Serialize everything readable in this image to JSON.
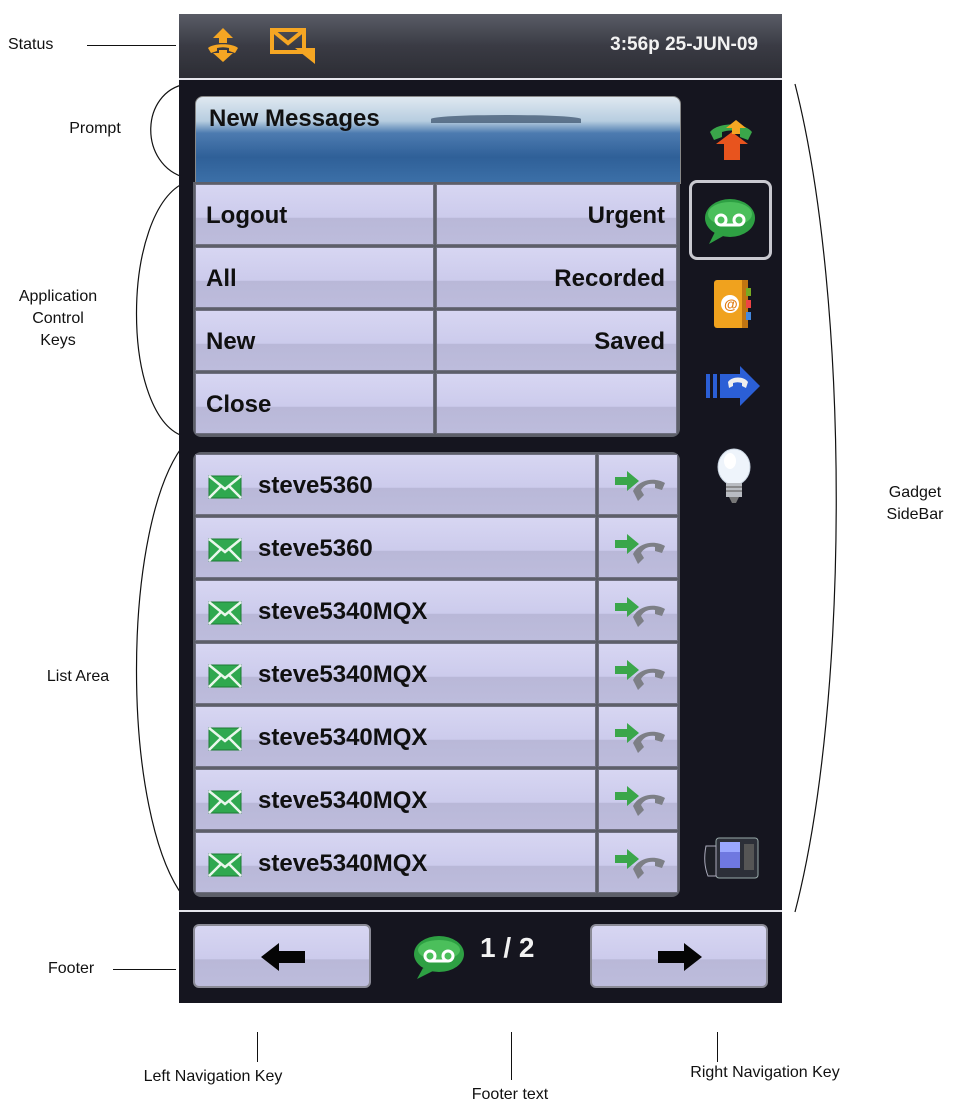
{
  "annotations": {
    "status": "Status",
    "prompt": "Prompt",
    "app_keys": [
      "Application",
      "Control",
      "Keys"
    ],
    "list_area": "List Area",
    "footer": "Footer",
    "gadget": [
      "Gadget",
      "SideBar"
    ],
    "left_nav": "Left Navigation Key",
    "footer_text": "Footer text",
    "right_nav": "Right Navigation Key"
  },
  "status_bar": {
    "time": "3:56p 25-JUN-09"
  },
  "prompt": {
    "title": "New Messages"
  },
  "keys": {
    "left": [
      "Logout",
      "All",
      "New",
      "Close"
    ],
    "right": [
      "Urgent",
      "Recorded",
      "Saved",
      ""
    ]
  },
  "messages": [
    "steve5360",
    "steve5360",
    "steve5340MQX",
    "steve5340MQX",
    "steve5340MQX",
    "steve5340MQX",
    "steve5340MQX"
  ],
  "footer": {
    "page": "1 / 2"
  },
  "sidebar": {
    "icons": [
      "call-transfer-icon",
      "voicemail-icon",
      "address-book-icon",
      "call-forward-icon",
      "lightbulb-icon",
      "desk-phone-icon"
    ]
  },
  "colors": {
    "screen_bg": "#15151f",
    "key_fill": "#cccbec",
    "status_icon": "#f5a623",
    "envelope": "#2fa84f"
  }
}
